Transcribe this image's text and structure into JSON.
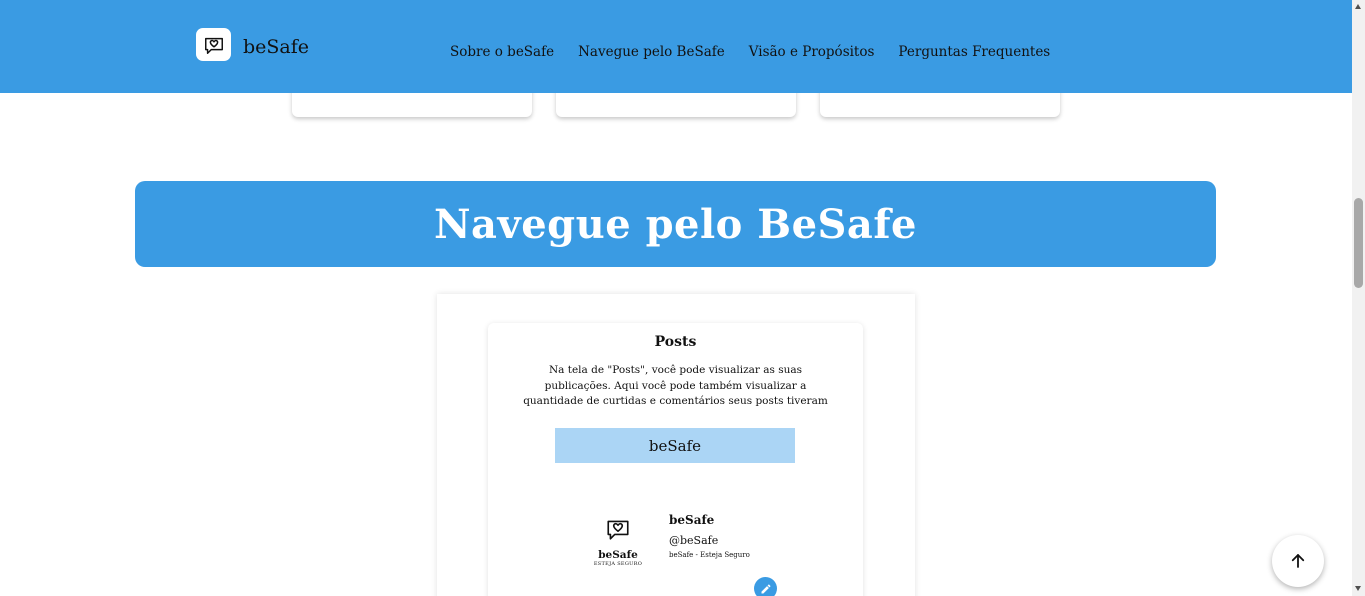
{
  "header": {
    "brand": "beSafe",
    "nav": [
      "Sobre o beSafe",
      "Navegue pelo BeSafe",
      "Visão e Propósitos",
      "Perguntas Frequentes"
    ],
    "color": "#3a9be3"
  },
  "section": {
    "title": "Navegue pelo BeSafe"
  },
  "posts_card": {
    "title": "Posts",
    "description": "Na tela de \"Posts\", você pode visualizar as suas publicações. Aqui você pode também visualizar a quantidade de curtidas e comentários seus posts tiveram",
    "mock_header": "beSafe",
    "mini_logo_name": "beSafe",
    "mini_logo_tagline": "ESTEJA SEGURO",
    "profile_name": "beSafe",
    "profile_handle": "@beSafe",
    "profile_bio": "beSafe - Esteja Seguro"
  },
  "icons": {
    "brand": "heart-chat-icon",
    "edit": "pencil-icon",
    "scroll_top": "arrow-up-icon"
  }
}
